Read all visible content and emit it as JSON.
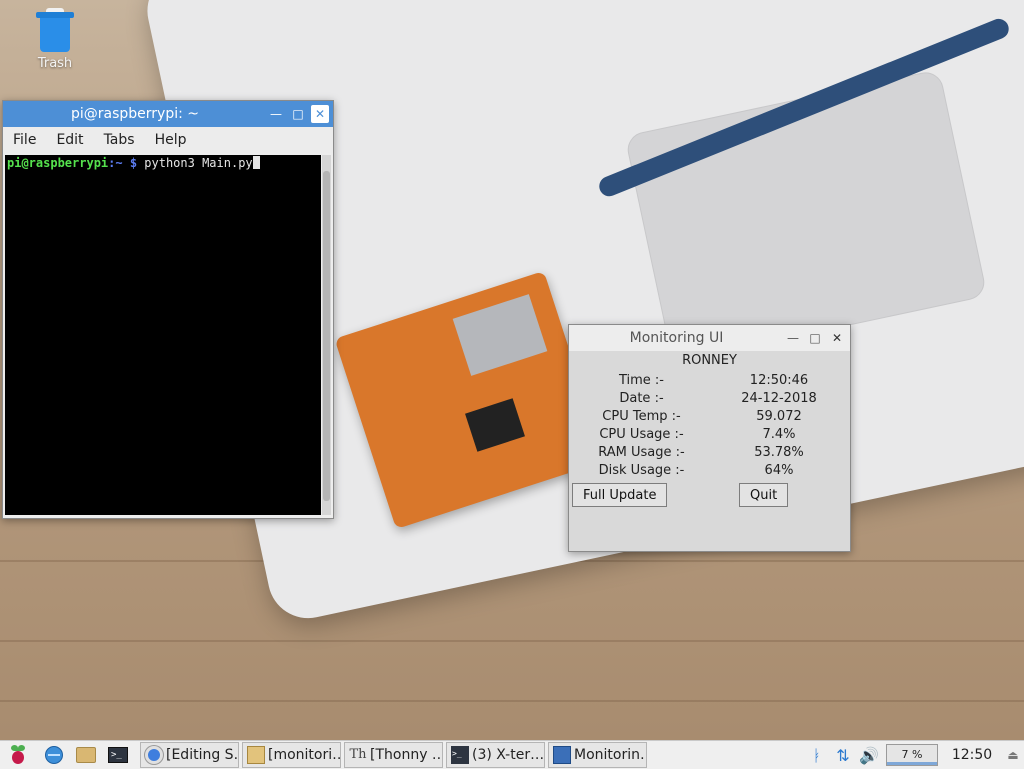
{
  "desktop": {
    "trash_label": "Trash"
  },
  "terminal": {
    "title": "pi@raspberrypi: ~",
    "menu": [
      "File",
      "Edit",
      "Tabs",
      "Help"
    ],
    "prompt_user": "pi@raspberrypi",
    "prompt_path": ":~ $",
    "command": " python3 Main.py"
  },
  "monitor": {
    "title": "Monitoring UI",
    "header": "RONNEY",
    "rows": [
      {
        "label": "Time :-",
        "value": "12:50:46"
      },
      {
        "label": "Date :-",
        "value": "24-12-2018"
      },
      {
        "label": "CPU Temp :-",
        "value": "59.072"
      },
      {
        "label": "CPU Usage :-",
        "value": "7.4%"
      },
      {
        "label": "RAM Usage :-",
        "value": "53.78%"
      },
      {
        "label": "Disk Usage :-",
        "value": "64%"
      }
    ],
    "full_update_label": "Full Update",
    "quit_label": "Quit"
  },
  "taskbar": {
    "tasks": [
      {
        "label": "[Editing S…",
        "icon": "chrome-icon"
      },
      {
        "label": "[monitori…",
        "icon": "folder-icon"
      },
      {
        "label": "[Thonny …",
        "icon": "thonny-icon"
      },
      {
        "label": "(3) X-ter…",
        "icon": "terminal-icon"
      },
      {
        "label": "Monitorin…",
        "icon": "window-icon"
      }
    ],
    "cpu_percent": "7 %",
    "clock": "12:50"
  },
  "colors": {
    "terminal_titlebar": "#4d8fd6",
    "prompt_user": "#55e14d",
    "prompt_path": "#5c7cf0",
    "tray_accent": "#2b79cf"
  }
}
